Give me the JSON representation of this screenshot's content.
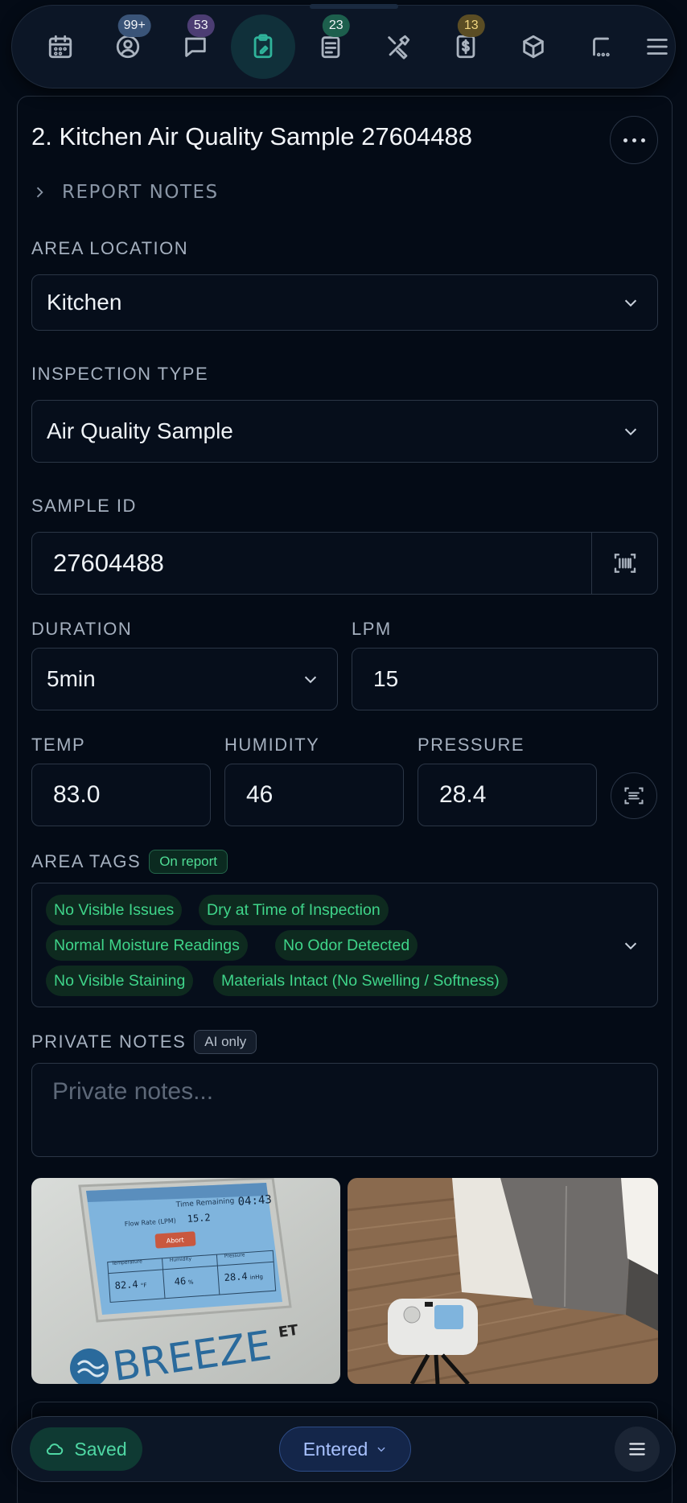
{
  "nav": {
    "badges": {
      "contacts": "99+",
      "messages": "53",
      "reports": "23",
      "invoices": "13"
    }
  },
  "card": {
    "title": "2. Kitchen Air Quality Sample 27604488",
    "report_notes_label": "REPORT NOTES",
    "area_location": {
      "label": "AREA LOCATION",
      "value": "Kitchen"
    },
    "inspection_type": {
      "label": "INSPECTION TYPE",
      "value": "Air Quality Sample"
    },
    "sample_id": {
      "label": "SAMPLE ID",
      "value": "27604488"
    },
    "duration": {
      "label": "DURATION",
      "value": "5min"
    },
    "lpm": {
      "label": "LPM",
      "value": "15"
    },
    "temp": {
      "label": "TEMP",
      "value": "83.0"
    },
    "humidity": {
      "label": "HUMIDITY",
      "value": "46"
    },
    "pressure": {
      "label": "PRESSURE",
      "value": "28.4"
    },
    "area_tags": {
      "label": "AREA TAGS",
      "badge": "On report",
      "tags": [
        "No Visible Issues",
        "Dry at Time of Inspection",
        "Normal Moisture Readings",
        "No Odor Detected",
        "No Visible Staining",
        "Materials Intact (No Swelling / Softness)"
      ]
    },
    "private_notes": {
      "label": "PRIVATE NOTES",
      "badge": "AI only",
      "placeholder": "Private notes..."
    },
    "photos": {
      "device_screen": {
        "brand": "BREEZE",
        "brand_sup": "ET",
        "time_remaining_label": "Time Remaining",
        "time_remaining": "04:43",
        "flow_rate_label": "Flow Rate (LPM)",
        "flow_rate": "15.2",
        "abort_label": "Abort",
        "col_labels": [
          "Temperature",
          "Humidity",
          "Pressure"
        ],
        "temperature": "82.4",
        "temperature_unit": "°F",
        "humidity": "46",
        "humidity_unit": "%",
        "pressure": "28.4",
        "pressure_unit": "inHg"
      }
    }
  },
  "bottom": {
    "saved_label": "Saved",
    "status_label": "Entered"
  },
  "colors": {
    "background": "#040b16",
    "accent_teal": "#2fb39a",
    "tag_green": "#3fd58a",
    "status_blue": "#a9c2ff"
  }
}
